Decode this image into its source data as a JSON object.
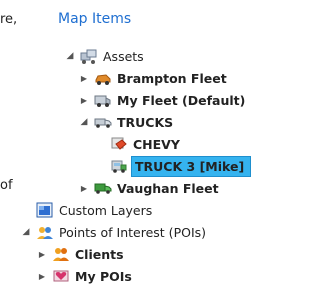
{
  "clipped_left_text": {
    "top": "re,",
    "bottom": "of"
  },
  "panel": {
    "title": "Map Items"
  },
  "tree": {
    "assets": {
      "label": "Assets",
      "icon": "assets-group-icon"
    },
    "brampton": {
      "label": "Brampton Fleet",
      "icon": "car-fleet-icon"
    },
    "myfleet": {
      "label": "My Fleet (Default)",
      "icon": "van-fleet-icon"
    },
    "trucks": {
      "label": "TRUCKS",
      "icon": "truck-fleet-icon"
    },
    "chevy": {
      "label": "CHEVY",
      "icon": "chevy-vehicle-icon"
    },
    "truck3": {
      "label": "TRUCK 3 [Mike]",
      "icon": "truck-vehicle-icon"
    },
    "vaughan": {
      "label": "Vaughan Fleet",
      "icon": "green-truck-fleet-icon"
    },
    "custom_layers": {
      "label": "Custom Layers",
      "icon": "layers-icon"
    },
    "poi": {
      "label": "Points of Interest (POIs)",
      "icon": "poi-group-icon"
    },
    "clients": {
      "label": "Clients",
      "icon": "clients-icon"
    },
    "mypois": {
      "label": "My POIs",
      "icon": "heart-poi-icon"
    }
  },
  "colors": {
    "link_blue": "#1f6fd1",
    "selection": "#35b3ef"
  }
}
